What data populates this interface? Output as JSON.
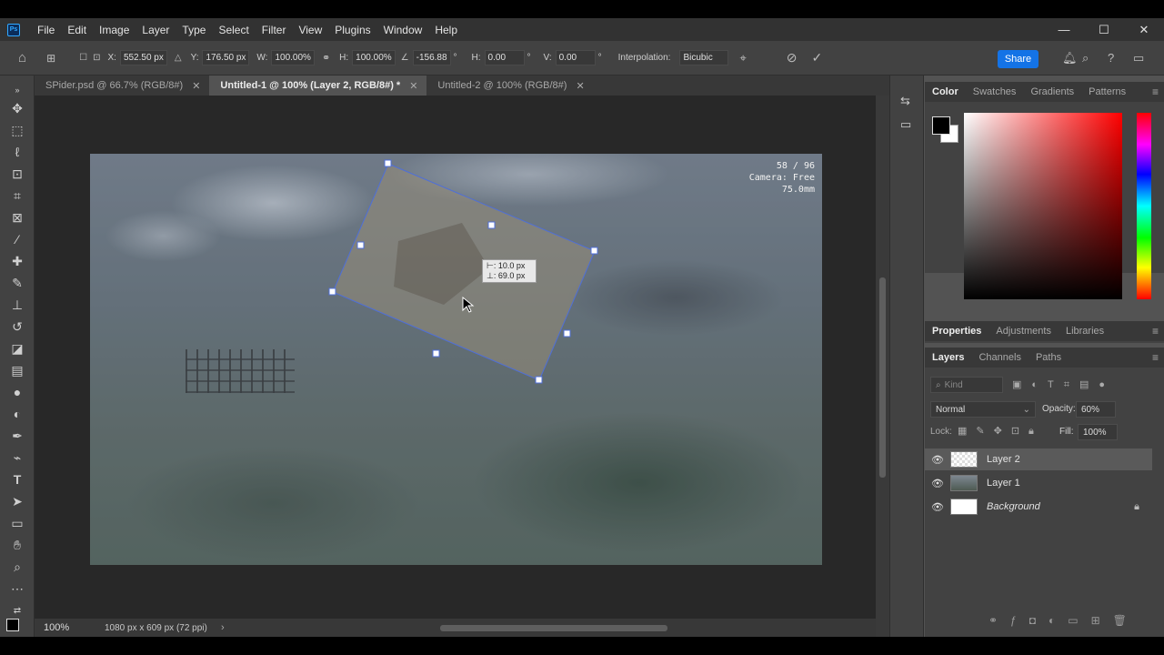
{
  "app": {
    "logo": "Ps",
    "menu": [
      "File",
      "Edit",
      "Image",
      "Layer",
      "Type",
      "Select",
      "Filter",
      "View",
      "Plugins",
      "Window",
      "Help"
    ],
    "window_controls": [
      "—",
      "☐",
      "✕"
    ]
  },
  "options": {
    "x_label": "X:",
    "x_value": "552.50 px",
    "y_label": "Y:",
    "y_value": "176.50 px",
    "w_label": "W:",
    "w_value": "100.00%",
    "h_label": "H:",
    "h_value": "100.00%",
    "angle_value": "-156.88",
    "angle_unit": "°",
    "hskew_label": "H:",
    "hskew_value": "0.00",
    "hskew_unit": "°",
    "vskew_label": "V:",
    "vskew_value": "0.00",
    "vskew_unit": "°",
    "interp_label": "Interpolation:",
    "interp_value": "Bicubic",
    "share_label": "Share"
  },
  "tabs": [
    {
      "label": "SPider.psd @ 66.7% (RGB/8#)",
      "close": "✕"
    },
    {
      "label": "Untitled-1 @ 100% (Layer 2, RGB/8#) *",
      "close": "✕"
    },
    {
      "label": "Untitled-2 @ 100% (RGB/8#)",
      "close": "✕"
    }
  ],
  "canvas": {
    "hud_line1": "58 / 96",
    "hud_line2": "Camera: Free",
    "hud_line3": "75.0mm",
    "tooltip_line1": "⊢: 10.0 px",
    "tooltip_line2": "⊥: 69.0 px"
  },
  "status": {
    "zoom": "100%",
    "doc_info": "1080 px x 609 px (72 ppi)",
    "arrow": "›"
  },
  "color_panel": {
    "tabs": [
      "Color",
      "Swatches",
      "Gradients",
      "Patterns"
    ],
    "foreground": "#000000",
    "background": "#ffffff"
  },
  "props_panel": {
    "tabs": [
      "Properties",
      "Adjustments",
      "Libraries"
    ]
  },
  "layers_panel": {
    "tabs": [
      "Layers",
      "Channels",
      "Paths"
    ],
    "search_placeholder": "Kind",
    "blend_mode": "Normal",
    "opacity_label": "Opacity:",
    "opacity_value": "60%",
    "lock_label": "Lock:",
    "fill_label": "Fill:",
    "fill_value": "100%",
    "layers": [
      {
        "name": "Layer 2",
        "selected": true
      },
      {
        "name": "Layer 1",
        "selected": false
      },
      {
        "name": "Background",
        "selected": false
      }
    ]
  }
}
